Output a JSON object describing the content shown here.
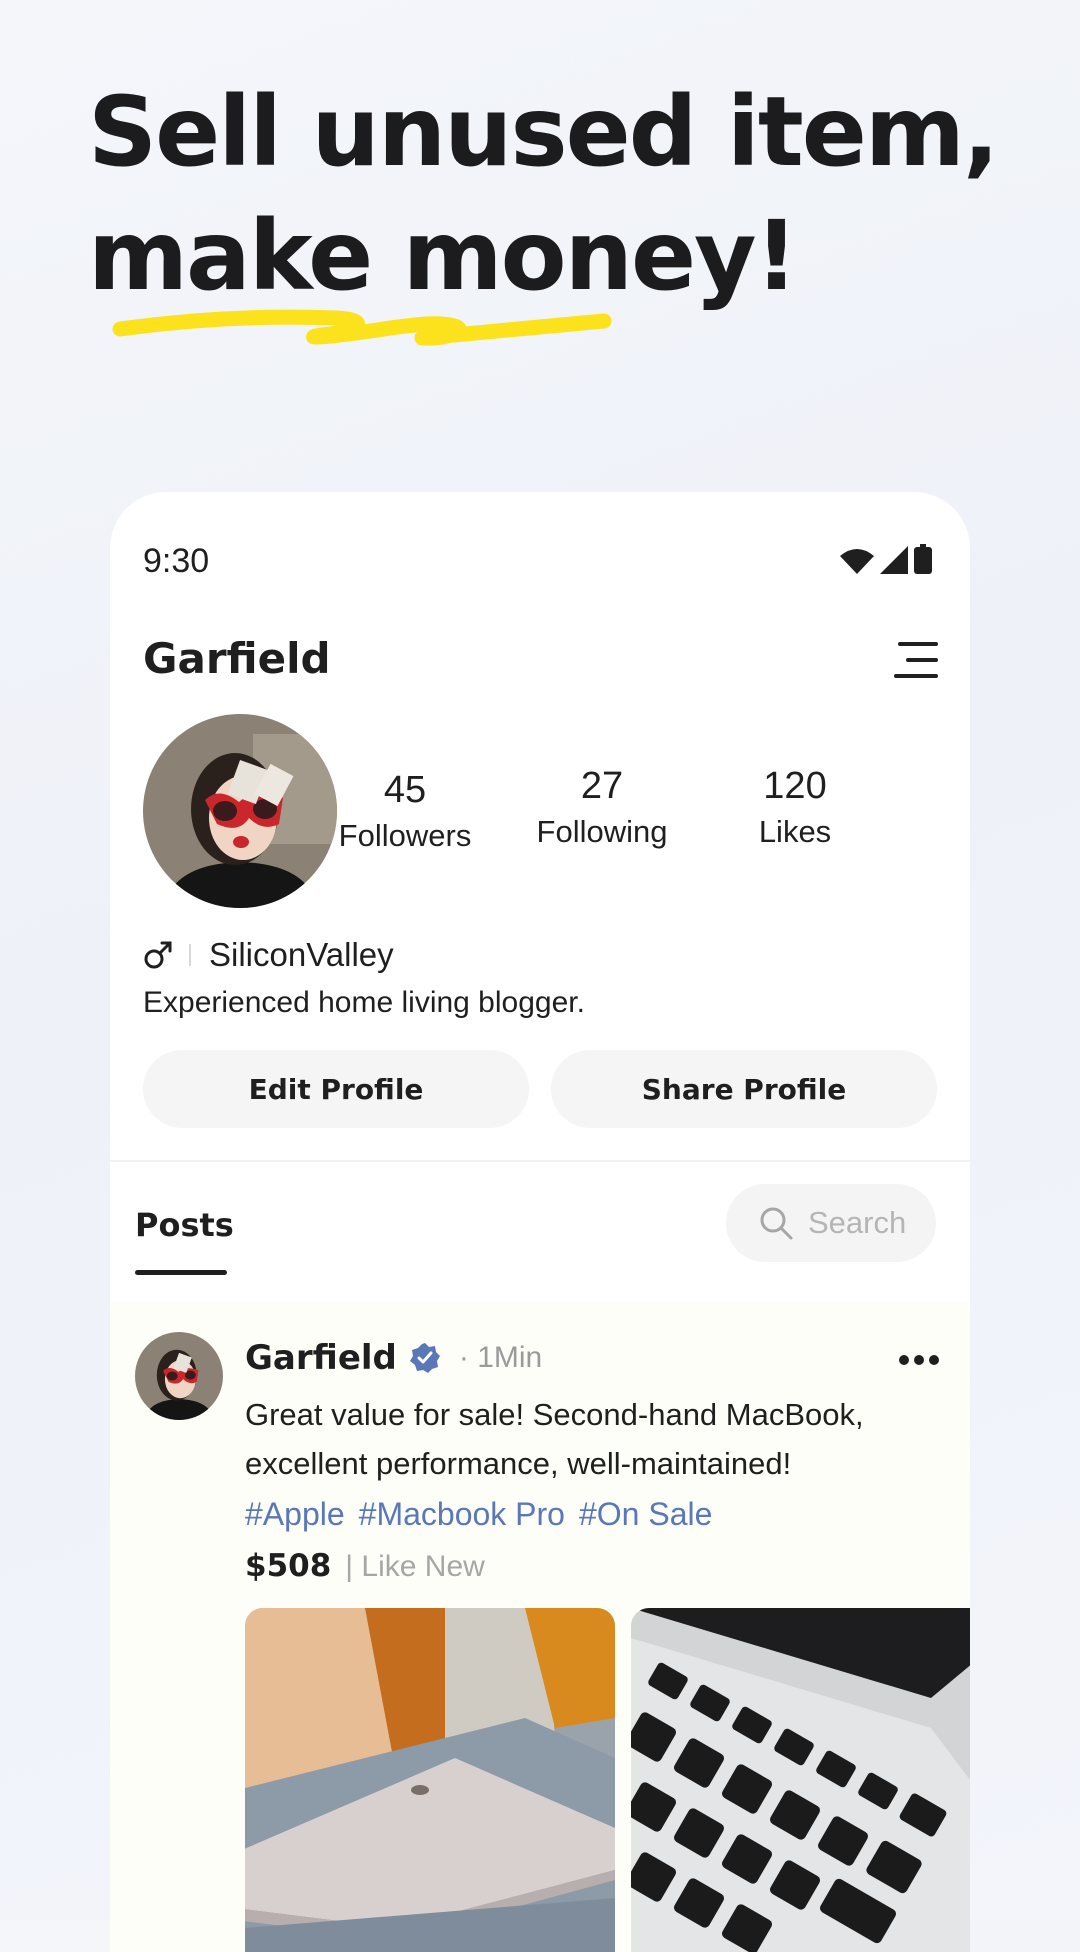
{
  "headline": {
    "line1": "Sell unused item,",
    "line2": "make money!"
  },
  "colors": {
    "accent_yellow": "#fbe21c",
    "tag_blue": "#5a77b8",
    "verified_blue": "#5a77b8"
  },
  "status_bar": {
    "time": "9:30",
    "icons": [
      "wifi-icon",
      "signal-icon",
      "battery-icon"
    ]
  },
  "profile": {
    "name": "Garfield",
    "stats": [
      {
        "value": "45",
        "label": "Followers"
      },
      {
        "value": "27",
        "label": "Following"
      },
      {
        "value": "120",
        "label": "Likes"
      }
    ],
    "gender_icon": "male-icon",
    "location": "SiliconValley",
    "bio": "Experienced home living blogger.",
    "edit_button": "Edit Profile",
    "share_button": "Share Profile"
  },
  "tabs": {
    "posts": "Posts"
  },
  "search": {
    "placeholder": "Search"
  },
  "post": {
    "author": "Garfield",
    "time": "· 1Min",
    "text": "Great value for sale! Second-hand MacBook, excellent performance, well-maintained!",
    "tags": [
      "#Apple",
      "#Macbook Pro",
      "#On Sale"
    ],
    "price": "$508",
    "condition": "| Like New"
  }
}
